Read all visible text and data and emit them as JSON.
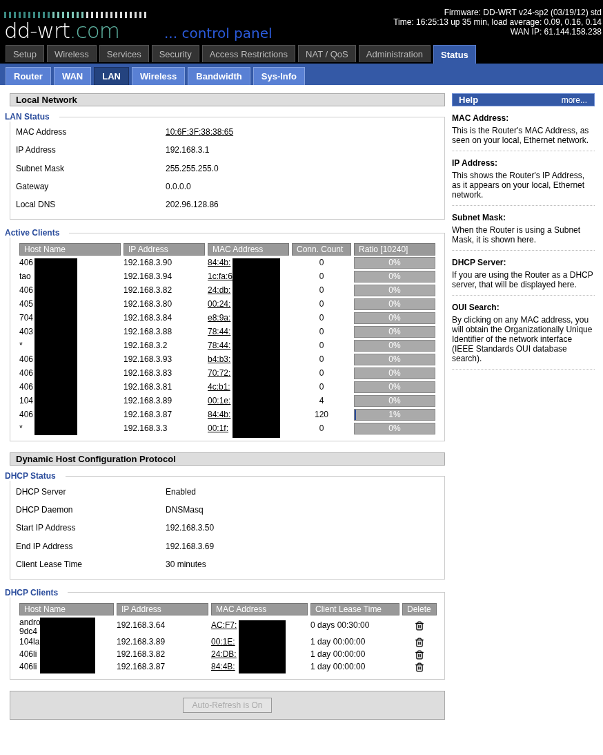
{
  "header": {
    "logo": {
      "main": "dd-wrt",
      "suffix": ".com"
    },
    "tagline": "... control panel",
    "info": [
      "Firmware: DD-WRT v24-sp2 (03/19/12) std",
      "Time: 16:25:13 up 35 min, load average: 0.09, 0.16, 0.14",
      "WAN IP: 61.144.158.238"
    ]
  },
  "tabs": [
    {
      "label": "Setup",
      "selected": false
    },
    {
      "label": "Wireless",
      "selected": false
    },
    {
      "label": "Services",
      "selected": false
    },
    {
      "label": "Security",
      "selected": false
    },
    {
      "label": "Access Restrictions",
      "selected": false
    },
    {
      "label": "NAT / QoS",
      "selected": false
    },
    {
      "label": "Administration",
      "selected": false
    },
    {
      "label": "Status",
      "selected": true
    }
  ],
  "subtabs": [
    {
      "label": "Router",
      "selected": false
    },
    {
      "label": "WAN",
      "selected": false
    },
    {
      "label": "LAN",
      "selected": true
    },
    {
      "label": "Wireless",
      "selected": false
    },
    {
      "label": "Bandwidth",
      "selected": false
    },
    {
      "label": "Sys-Info",
      "selected": false
    }
  ],
  "local_network": {
    "title": "Local Network",
    "lan_status": {
      "legend": "LAN Status",
      "rows": [
        {
          "label": "MAC Address",
          "value": "10:6F:3F:38:38:65",
          "kind": "link"
        },
        {
          "label": "IP Address",
          "value": "192.168.3.1",
          "kind": "text"
        },
        {
          "label": "Subnet Mask",
          "value": "255.255.255.0",
          "kind": "text"
        },
        {
          "label": "Gateway",
          "value": "0.0.0.0",
          "kind": "text"
        },
        {
          "label": "Local DNS",
          "value": "202.96.128.86",
          "kind": "text"
        }
      ]
    },
    "active_clients": {
      "legend": "Active Clients",
      "columns": [
        "Host Name",
        "IP Address",
        "MAC Address",
        "Conn. Count",
        "Ratio [10240]"
      ],
      "rows": [
        {
          "host": "406",
          "ip": "192.168.3.90",
          "mac": "84:4b:",
          "conn": "0",
          "level": 0,
          "ratio": "0%"
        },
        {
          "host": "tao",
          "ip": "192.168.3.94",
          "mac": "1c:fa:6",
          "conn": "0",
          "level": 0,
          "ratio": "0%"
        },
        {
          "host": "406",
          "ip": "192.168.3.82",
          "mac": "24:db:",
          "conn": "0",
          "level": 0,
          "ratio": "0%"
        },
        {
          "host": "405",
          "ip": "192.168.3.80",
          "mac": "00:24:",
          "conn": "0",
          "level": 0,
          "ratio": "0%"
        },
        {
          "host": "704",
          "ip": "192.168.3.84",
          "mac": "e8:9a:",
          "conn": "0",
          "level": 0,
          "ratio": "0%"
        },
        {
          "host": "403",
          "ip": "192.168.3.88",
          "mac": "78:44:",
          "conn": "0",
          "level": 0,
          "ratio": "0%"
        },
        {
          "host": "*",
          "ip": "192.168.3.2",
          "mac": "78:44:",
          "conn": "0",
          "level": 0,
          "ratio": "0%"
        },
        {
          "host": "406",
          "ip": "192.168.3.93",
          "mac": "b4:b3:",
          "conn": "0",
          "level": 0,
          "ratio": "0%"
        },
        {
          "host": "406",
          "ip": "192.168.3.83",
          "mac": "70:72:",
          "conn": "0",
          "level": 0,
          "ratio": "0%"
        },
        {
          "host": "406",
          "ip": "192.168.3.81",
          "mac": "4c:b1:",
          "conn": "0",
          "level": 0,
          "ratio": "0%"
        },
        {
          "host": "104",
          "ip": "192.168.3.89",
          "mac": "00:1e:",
          "conn": "4",
          "level": 0,
          "ratio": "0%"
        },
        {
          "host": "406",
          "ip": "192.168.3.87",
          "mac": "84:4b:",
          "conn": "120",
          "level": 0.01,
          "ratio": "1%"
        },
        {
          "host": "*",
          "ip": "192.168.3.3",
          "mac": "00:1f:",
          "conn": "0",
          "level": 0,
          "ratio": "0%"
        }
      ]
    }
  },
  "dhcp": {
    "title": "Dynamic Host Configuration Protocol",
    "status": {
      "legend": "DHCP Status",
      "rows": [
        {
          "label": "DHCP Server",
          "value": "Enabled",
          "kind": "text"
        },
        {
          "label": "DHCP Daemon",
          "value": "DNSMasq",
          "kind": "text"
        },
        {
          "label": "Start IP Address",
          "value": "192.168.3.50",
          "kind": "text"
        },
        {
          "label": "End IP Address",
          "value": "192.168.3.69",
          "kind": "text"
        },
        {
          "label": "Client Lease Time",
          "value": "30 minutes",
          "kind": "text"
        }
      ]
    },
    "clients": {
      "legend": "DHCP Clients",
      "columns": [
        "Host Name",
        "IP Address",
        "MAC Address",
        "Client Lease Time",
        "Delete"
      ],
      "rows": [
        {
          "host": "andro\n9dc4",
          "ip": "192.168.3.64",
          "mac": "AC:F7:",
          "lease": "0 days 00:30:00"
        },
        {
          "host": "104la",
          "ip": "192.168.3.89",
          "mac": "00:1E:",
          "lease": "1 day 00:00:00"
        },
        {
          "host": "406li",
          "ip": "192.168.3.82",
          "mac": "24:DB:",
          "lease": "1 day 00:00:00"
        },
        {
          "host": "406li",
          "ip": "192.168.3.87",
          "mac": "84:4B:",
          "lease": "1 day 00:00:00"
        }
      ]
    }
  },
  "refresh_button": {
    "label": "Auto-Refresh is On",
    "disabled": true
  },
  "help": {
    "title": "Help",
    "more": "more...",
    "items": [
      {
        "heading": "MAC Address:",
        "text": "This is the Router's MAC Address, as seen on your local, Ethernet network."
      },
      {
        "heading": "IP Address:",
        "text": "This shows the Router's IP Address, as it appears on your local, Ethernet network."
      },
      {
        "heading": "Subnet Mask:",
        "text": "When the Router is using a Subnet Mask, it is shown here."
      },
      {
        "heading": "DHCP Server:",
        "text": "If you are using the Router as a DHCP server, that will be displayed here."
      },
      {
        "heading": "OUI Search:",
        "text": "By clicking on any MAC address, you will obtain the Organizationally Unique Identifier of the network interface (IEEE Standards OUI database search)."
      }
    ]
  }
}
